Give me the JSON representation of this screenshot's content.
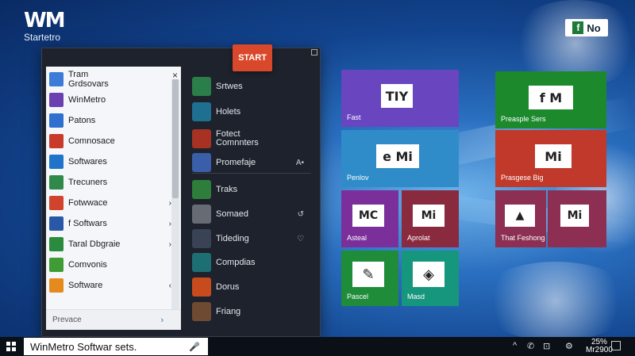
{
  "desktop": {
    "logo_mark": "WM",
    "logo_sub": "Startetro",
    "corner_badge": "No",
    "corner_badge_f": "f"
  },
  "start_menu": {
    "start_label": "START",
    "close_glyph": "×",
    "left_list": [
      {
        "label": "Tram\nGrdsovars",
        "color": "#3c7bd6",
        "chev": ""
      },
      {
        "label": "WinMetro",
        "color": "#6b3fb0",
        "chev": ""
      },
      {
        "label": "Patons",
        "color": "#2e6fcf",
        "chev": ""
      },
      {
        "label": "Comnosace",
        "color": "#c83a2a",
        "chev": ""
      },
      {
        "label": "Softwares",
        "color": "#1f74c9",
        "chev": ""
      },
      {
        "label": "Trecuners",
        "color": "#2f8a4a",
        "chev": ""
      },
      {
        "label": "Fotwwace",
        "color": "#d0432c",
        "chev": "›"
      },
      {
        "label": "f Softwars",
        "color": "#2958a8",
        "chev": "›"
      },
      {
        "label": "Taral Dbgraie",
        "color": "#2a8b3e",
        "chev": "›"
      },
      {
        "label": "Comvonis",
        "color": "#3f9b33",
        "chev": ""
      },
      {
        "label": "Software",
        "color": "#e58a1c",
        "chev": "‹"
      }
    ],
    "footer_label": "Prevace",
    "footer_arrow": "›",
    "dark_list": [
      {
        "label": "Srtwes",
        "color": "#2b7e4a",
        "end": ""
      },
      {
        "label": "Holets",
        "color": "#1f6f90",
        "end": ""
      },
      {
        "label": "Fotect\nComnnters",
        "color": "#a73224",
        "end": ""
      },
      {
        "label": "Promefaje",
        "color": "#3a5fa8",
        "end": "A•"
      },
      {
        "label": "Traks",
        "color": "#2f7d3a",
        "end": ""
      },
      {
        "label": "Somaed",
        "color": "#666b74",
        "end": "↺"
      },
      {
        "label": "Tideding",
        "color": "#3a4256",
        "end": "♡"
      },
      {
        "label": "Compdias",
        "color": "#1e6f73",
        "end": ""
      },
      {
        "label": "Dorus",
        "color": "#c84b1e",
        "end": ""
      },
      {
        "label": "Friang",
        "color": "#6e4a32",
        "end": ""
      }
    ]
  },
  "tiles": [
    {
      "label": "Fast",
      "glyph": "TIY",
      "color": "#6a45c0"
    },
    {
      "label": "Preasple Sers",
      "glyph": "f M",
      "color": "#1c8a2c"
    },
    {
      "label": "Penlov",
      "glyph": "e Mi",
      "color": "#2f8cc8"
    },
    {
      "label": "Prasgese Big",
      "glyph": "Mi",
      "color": "#c0392b"
    },
    {
      "label": "Asteal",
      "glyph": "MC",
      "color": "#7a2f9a"
    },
    {
      "label": "Aprolat",
      "glyph": "Mi",
      "color": "#8a2a3e"
    },
    {
      "label": "That Feshong",
      "glyph": "▲",
      "color": "#8c2f52"
    },
    {
      "label": "",
      "glyph": "Mi",
      "color": "#8c2f52"
    },
    {
      "label": "Pascel",
      "glyph": "✎",
      "color": "#1f8c3a"
    },
    {
      "label": "Masd",
      "glyph": "◈",
      "color": "#17967e"
    }
  ],
  "taskbar": {
    "search_text": "WinMetro Softwar sets.",
    "mic": "🎤",
    "tray_icons": [
      "^",
      "✆",
      "⊡",
      "⚙"
    ],
    "battery": "25%",
    "time": "Mr2900"
  }
}
